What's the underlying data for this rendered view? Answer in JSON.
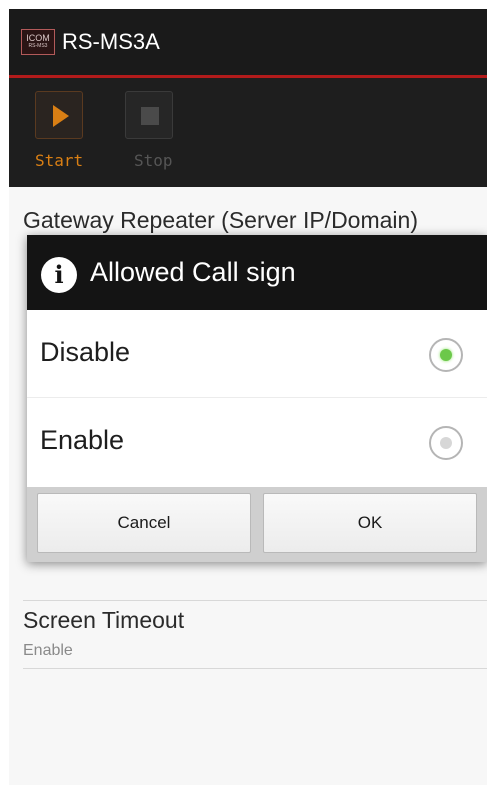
{
  "app": {
    "logo_text": "ICOM",
    "logo_sub": "RS-MS3",
    "title": "RS-MS3A"
  },
  "toolbar": {
    "start_label": "Start",
    "stop_label": "Stop",
    "start_color": "#d97f14",
    "stop_color": "#555555"
  },
  "settings": {
    "gateway_title": "Gateway Repeater (Server IP/Domain)",
    "screen_timeout_title": "Screen Timeout",
    "screen_timeout_value": "Enable"
  },
  "dialog": {
    "icon": "info-icon",
    "title": "Allowed Call sign",
    "options": [
      {
        "label": "Disable",
        "selected": true
      },
      {
        "label": "Enable",
        "selected": false
      }
    ],
    "cancel_label": "Cancel",
    "ok_label": "OK",
    "accent_color": "#6cc84a"
  }
}
